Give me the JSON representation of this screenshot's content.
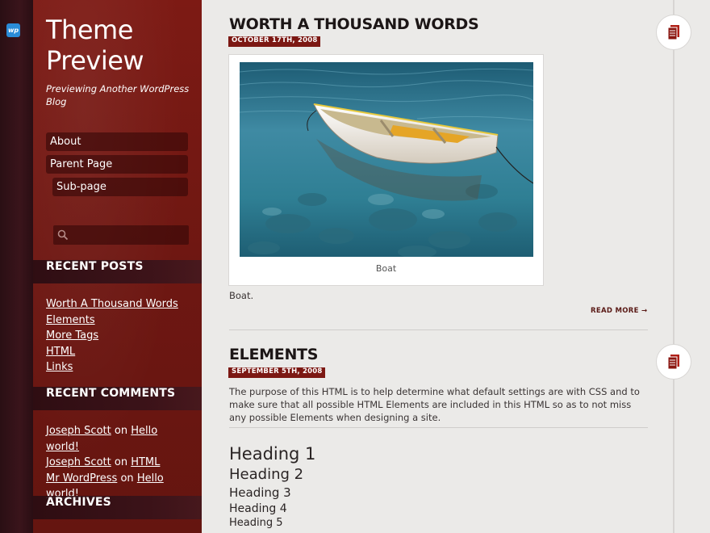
{
  "site": {
    "title_line1": "Theme",
    "title_line2": "Preview",
    "description": "Previewing Another WordPress Blog",
    "wp_badge": "wp"
  },
  "nav": {
    "items": [
      {
        "label": "About"
      },
      {
        "label": "Parent Page"
      },
      {
        "label": "Sub-page"
      }
    ]
  },
  "search": {
    "placeholder": "",
    "value": ""
  },
  "widgets": {
    "recent_posts": {
      "title": "RECENT POSTS",
      "items": [
        "Worth A Thousand Words",
        "Elements",
        "More Tags",
        "HTML",
        "Links"
      ]
    },
    "recent_comments": {
      "title": "RECENT COMMENTS",
      "on": "on",
      "items": [
        {
          "author": "Joseph Scott",
          "post": "Hello world!"
        },
        {
          "author": "Joseph Scott",
          "post": "HTML"
        },
        {
          "author": "Mr WordPress",
          "post": "Hello world!"
        }
      ]
    },
    "archives": {
      "title": "ARCHIVES"
    }
  },
  "posts": [
    {
      "title": "WORTH A THOUSAND WORDS",
      "date": "OCTOBER 17TH, 2008",
      "image_caption": "Boat",
      "excerpt": "Boat.",
      "read_more": "READ MORE →"
    },
    {
      "title": "ELEMENTS",
      "date": "SEPTEMBER 5TH, 2008",
      "excerpt": "The purpose of this HTML is to help determine what default settings are with CSS and to make sure that all possible HTML Elements are included in this HTML so as to not miss any possible Elements when designing a site.",
      "headings": [
        "Heading 1",
        "Heading 2",
        "Heading 3",
        "Heading 4",
        "Heading 5"
      ]
    }
  ],
  "colors": {
    "sidebar": "#6e1712",
    "accent": "#7c1813",
    "background": "#ebeae8",
    "widget_title_bg": "#2e1018"
  }
}
